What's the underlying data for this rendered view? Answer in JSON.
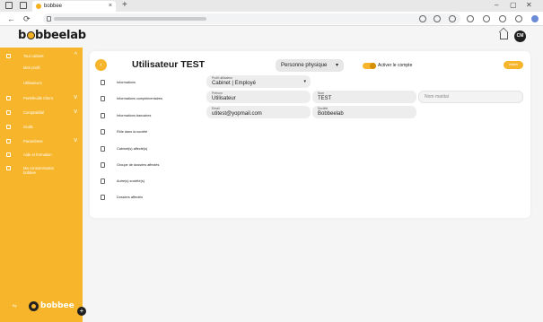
{
  "browser": {
    "tab_title": "bobbee",
    "new_tab": "+",
    "tab_close": "×",
    "win_min": "–",
    "win_max": "▢",
    "win_close": "✕",
    "back": "←",
    "reload": "⟳"
  },
  "sidebar": {
    "logo_pre": "b",
    "logo_mid": "bbeelab",
    "items": [
      {
        "label": "Tout cabinet",
        "chevron": "^"
      },
      {
        "label": "Mon profil",
        "chevron": ""
      },
      {
        "label": "Utilisateurs",
        "chevron": ""
      },
      {
        "label": "Portefeuille Client",
        "chevron": "v"
      },
      {
        "label": "Comptabilité",
        "chevron": "v"
      },
      {
        "label": "Outils",
        "chevron": ""
      },
      {
        "label": "Paramètres",
        "chevron": "v"
      },
      {
        "label": "Aide et formation",
        "chevron": ""
      },
      {
        "label": "Ma consommation bobbee",
        "chevron": ""
      }
    ],
    "footer_text": "By",
    "brand": "bobbee",
    "plus": "+"
  },
  "header": {
    "avatar_initials": "CM"
  },
  "main": {
    "back_symbol": "‹",
    "title": "Utilisateur TEST",
    "person_type": "Personne physique",
    "toggle_label": "Activer le compte",
    "toggle_on": true,
    "save_label": "Valider",
    "sections": [
      "Informations",
      "Informations complémentaires",
      "Informations bancaires",
      "Rôle dans la société",
      "Cabinet(s) affecté(s)",
      "Groupe de dossiers affectés",
      "Autre(s) société(s)",
      "Dossiers affectés"
    ],
    "fields": {
      "profil": {
        "label": "Profil utilisateur",
        "value": "Cabinet | Employé"
      },
      "prenom": {
        "label": "Prénom",
        "value": "Utilisateur"
      },
      "nom": {
        "label": "Nom",
        "value": "TEST"
      },
      "nom_marital": {
        "placeholder": "Nom marital"
      },
      "email": {
        "label": "Email",
        "value": "utitest@yopmail.com"
      },
      "societe": {
        "label": "Société",
        "value": "Bobbeelab"
      }
    }
  },
  "colors": {
    "accent": "#f6b52a",
    "dark": "#1f1f1f"
  }
}
